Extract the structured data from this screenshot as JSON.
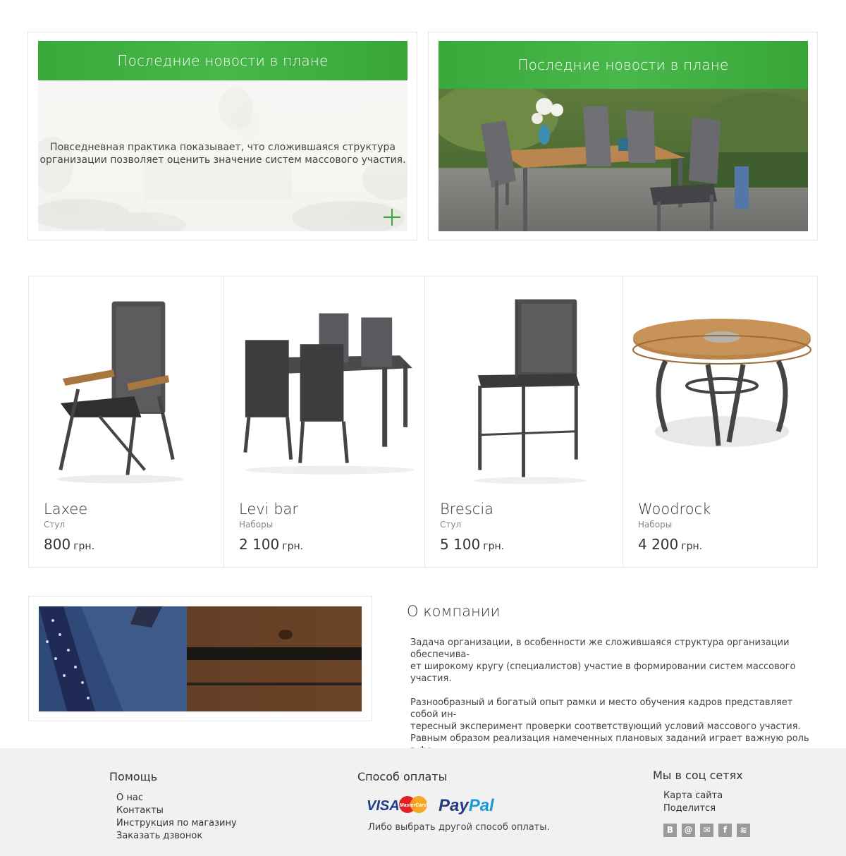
{
  "news": [
    {
      "title": "Последние новости в плане",
      "text_line1": "Повседневная практика показывает, что сложившаяся структура",
      "text_line2": "организации позволяет оценить значение систем массового участия."
    },
    {
      "title": "Последние новости в плане"
    }
  ],
  "products": [
    {
      "name": "Laxee",
      "category": "Стул",
      "price": "800",
      "currency": "грн."
    },
    {
      "name": "Levi bar",
      "category": "Наборы",
      "price": "2 100",
      "currency": "грн."
    },
    {
      "name": "Brescia",
      "category": "Стул",
      "price": "5 100",
      "currency": "грн."
    },
    {
      "name": "Woodrock",
      "category": "Наборы",
      "price": "4 200",
      "currency": "грн."
    }
  ],
  "about": {
    "title": "О компании",
    "p1_line1": "Задача организации, в особенности же сложившаяся структура организации обеспечива-",
    "p1_line2": "ет широкому кругу (специалистов) участие в формировании систем массового участия.",
    "p2_line1": "Разнообразный и богатый опыт рамки и место обучения кадров представляет собой ин-",
    "p2_line2": "тересный эксперимент проверки соответствующий условий массового участия.",
    "p2_line3": "Равным образом реализация намеченных плановых заданий играет важную роль в фо...."
  },
  "footer": {
    "help": {
      "title": "Помощь",
      "links": [
        "О нас",
        "Контакты",
        "Инструкция по магазину",
        "Заказать дзвонок"
      ]
    },
    "payment": {
      "title": "Способ оплаты",
      "visa": "VISA",
      "mastercard": "MasterCard",
      "paypal_pay": "Pay",
      "paypal_pal": "Pal",
      "note": "Либо выбрать другой способ оплаты."
    },
    "social": {
      "title": "Мы в соц сетях",
      "links": [
        "Карта сайта",
        "Поделится"
      ],
      "icons": [
        "vk-icon",
        "at-icon",
        "mail-icon",
        "facebook-icon",
        "rss-icon"
      ],
      "icon_glyphs": [
        "B",
        "@",
        "✉",
        "f",
        "≋"
      ]
    }
  },
  "colors": {
    "accent_green": "#3aa83a",
    "icon_grey": "#9a9a9a",
    "footer_bg": "#f1f1f1"
  }
}
